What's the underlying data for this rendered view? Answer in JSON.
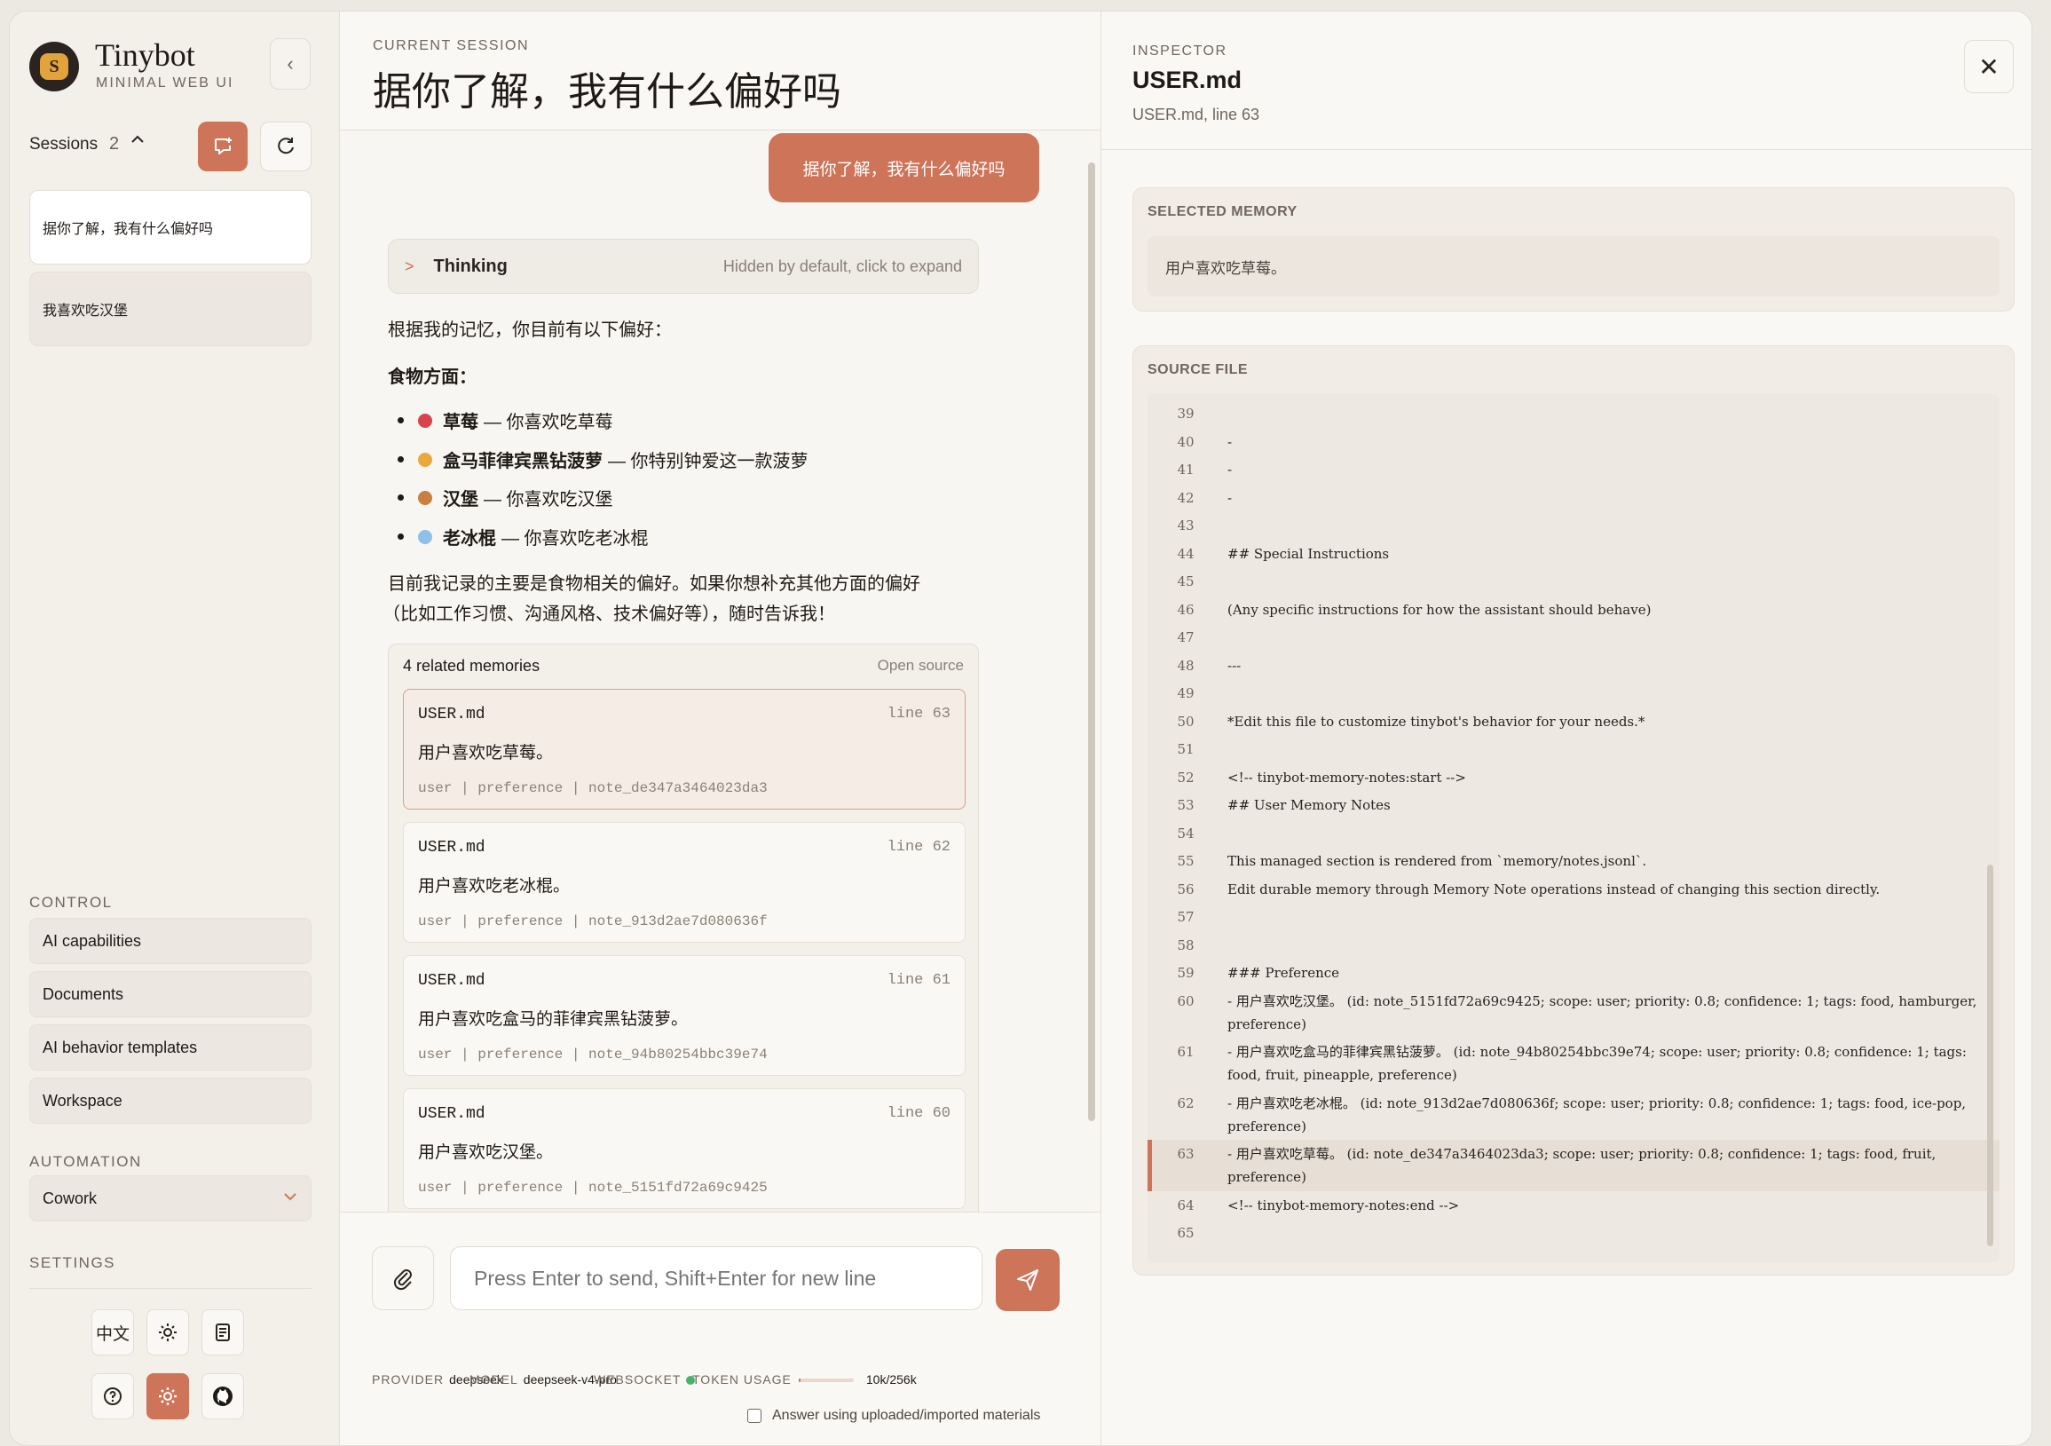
{
  "app": {
    "name": "Tinybot",
    "subtitle": "MINIMAL WEB UI"
  },
  "sidebar": {
    "sessions_label": "Sessions",
    "sessions_count": "2",
    "sessions": [
      {
        "title": "据你了解，我有什么偏好吗",
        "active": true
      },
      {
        "title": "我喜欢吃汉堡",
        "active": false
      }
    ],
    "control_label": "CONTROL",
    "control_items": [
      "AI capabilities",
      "Documents",
      "AI behavior templates",
      "Workspace"
    ],
    "automation_label": "AUTOMATION",
    "automation_value": "Cowork",
    "settings_label": "SETTINGS",
    "lang_button": "中文"
  },
  "chat": {
    "header_label": "CURRENT SESSION",
    "title": "据你了解，我有什么偏好吗",
    "user_message": "据你了解，我有什么偏好吗",
    "thinking": {
      "label": "Thinking",
      "hint": "Hidden by default, click to expand"
    },
    "answer_intro": "根据我的记忆，你目前有以下偏好：",
    "food_heading": "食物方面：",
    "prefs": [
      {
        "name": "草莓",
        "desc": "— 你喜欢吃草莓",
        "emoji_color": "#d9434b"
      },
      {
        "name": "盒马菲律宾黑钻菠萝",
        "desc": "— 你特别钟爱这一款菠萝",
        "emoji_color": "#e9a93a"
      },
      {
        "name": "汉堡",
        "desc": "— 你喜欢吃汉堡",
        "emoji_color": "#c9803f"
      },
      {
        "name": "老冰棍",
        "desc": "— 你喜欢吃老冰棍",
        "emoji_color": "#8fc0ea"
      }
    ],
    "answer_outro_1": "目前我记录的主要是食物相关的偏好。如果你想补充其他方面的偏好",
    "answer_outro_2": "（比如工作习惯、沟通风格、技术偏好等），随时告诉我！",
    "memories": {
      "header": "4 related memories",
      "open_source": "Open source",
      "items": [
        {
          "file": "USER.md",
          "line": "line 63",
          "text": "用户喜欢吃草莓。",
          "meta": "user | preference | note_de347a3464023da3",
          "selected": true
        },
        {
          "file": "USER.md",
          "line": "line 62",
          "text": "用户喜欢吃老冰棍。",
          "meta": "user | preference | note_913d2ae7d080636f",
          "selected": false
        },
        {
          "file": "USER.md",
          "line": "line 61",
          "text": "用户喜欢吃盒马的菲律宾黑钻菠萝。",
          "meta": "user | preference | note_94b80254bbc39e74",
          "selected": false
        },
        {
          "file": "USER.md",
          "line": "line 60",
          "text": "用户喜欢吃汉堡。",
          "meta": "user | preference | note_5151fd72a69c9425",
          "selected": false
        }
      ]
    },
    "composer": {
      "placeholder": "Press Enter to send, Shift+Enter for new line"
    },
    "status": {
      "provider_label": "PROVIDER",
      "provider": "deepseek",
      "model_label": "MODEL",
      "model": "deepseek-v4-pro",
      "ws_label": "WEBSOCKET",
      "token_label": "TOKEN USAGE",
      "token": "10k/256k",
      "token_fraction": 0.04
    },
    "materials_label": "Answer using uploaded/imported materials"
  },
  "inspector": {
    "label": "INSPECTOR",
    "title": "USER.md",
    "subtitle": "USER.md, line 63",
    "selected_label": "SELECTED MEMORY",
    "selected_text": "用户喜欢吃草莓。",
    "source_label": "SOURCE FILE",
    "lines": [
      {
        "n": "39",
        "t": ""
      },
      {
        "n": "40",
        "t": "-"
      },
      {
        "n": "41",
        "t": "-"
      },
      {
        "n": "42",
        "t": "-"
      },
      {
        "n": "43",
        "t": ""
      },
      {
        "n": "44",
        "t": "## Special Instructions"
      },
      {
        "n": "45",
        "t": ""
      },
      {
        "n": "46",
        "t": "(Any specific instructions for how the assistant should behave)"
      },
      {
        "n": "47",
        "t": ""
      },
      {
        "n": "48",
        "t": "---"
      },
      {
        "n": "49",
        "t": ""
      },
      {
        "n": "50",
        "t": "*Edit this file to customize tinybot's behavior for your needs.*"
      },
      {
        "n": "51",
        "t": ""
      },
      {
        "n": "52",
        "t": "<!-- tinybot-memory-notes:start -->"
      },
      {
        "n": "53",
        "t": "## User Memory Notes"
      },
      {
        "n": "54",
        "t": ""
      },
      {
        "n": "55",
        "t": "This managed section is rendered from `memory/notes.jsonl`."
      },
      {
        "n": "56",
        "t": "Edit durable memory through Memory Note operations instead of changing this section directly."
      },
      {
        "n": "57",
        "t": ""
      },
      {
        "n": "58",
        "t": ""
      },
      {
        "n": "59",
        "t": "### Preference"
      },
      {
        "n": "60",
        "t": "- 用户喜欢吃汉堡。 (id: note_5151fd72a69c9425; scope: user; priority: 0.8; confidence: 1; tags: food, hamburger, preference)"
      },
      {
        "n": "61",
        "t": "- 用户喜欢吃盒马的菲律宾黑钻菠萝。 (id: note_94b80254bbc39e74; scope: user; priority: 0.8; confidence: 1; tags: food, fruit, pineapple, preference)"
      },
      {
        "n": "62",
        "t": "- 用户喜欢吃老冰棍。 (id: note_913d2ae7d080636f; scope: user; priority: 0.8; confidence: 1; tags: food, ice-pop, preference)"
      },
      {
        "n": "63",
        "t": "- 用户喜欢吃草莓。 (id: note_de347a3464023da3; scope: user; priority: 0.8; confidence: 1; tags: food, fruit, preference)",
        "highlight": true
      },
      {
        "n": "64",
        "t": "<!-- tinybot-memory-notes:end -->"
      },
      {
        "n": "65",
        "t": ""
      }
    ]
  },
  "colors": {
    "accent": "#cd7459",
    "ws_online": "#46b36a"
  }
}
